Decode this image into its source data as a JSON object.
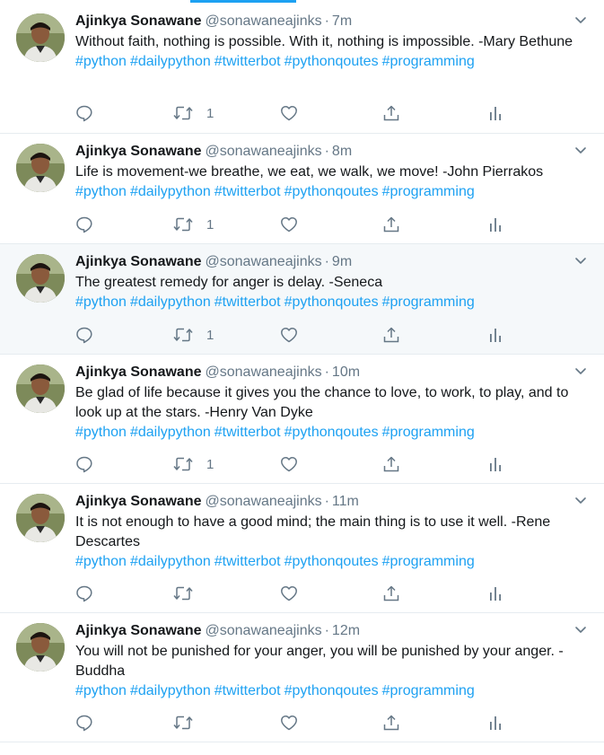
{
  "author": {
    "name": "Ajinkya Sonawane",
    "handle": "@sonawaneajinks",
    "separator": "·"
  },
  "tweets": [
    {
      "time": "7m",
      "text": "Without faith, nothing is possible. With it, nothing is impossible.  -Mary Bethune",
      "hashtags": [
        "#python",
        "#dailypython",
        "#twitterbot",
        "#pythonqoutes",
        "#programming"
      ],
      "retweet_count": "1",
      "hovered": false
    },
    {
      "time": "8m",
      "text": "Life is movement-we breathe, we eat, we walk, we move!  -John Pierrakos",
      "hashtags": [
        "#python",
        "#dailypython",
        "#twitterbot",
        "#pythonqoutes",
        "#programming"
      ],
      "retweet_count": "1",
      "hovered": false
    },
    {
      "time": "9m",
      "text": "The greatest remedy for anger is delay.  -Seneca",
      "hashtags": [
        "#python",
        "#dailypython",
        "#twitterbot",
        "#pythonqoutes",
        "#programming"
      ],
      "retweet_count": "1",
      "hovered": true
    },
    {
      "time": "10m",
      "text": "Be glad of life because it gives you the chance to love, to work, to play, and to look up at the stars.  -Henry Van Dyke",
      "hashtags": [
        "#python",
        "#dailypython",
        "#twitterbot",
        "#pythonqoutes",
        "#programming"
      ],
      "retweet_count": "1",
      "hovered": false
    },
    {
      "time": "11m",
      "text": "It is not enough to have a good mind; the main thing is to use it well.   -Rene Descartes",
      "hashtags": [
        "#python",
        "#dailypython",
        "#twitterbot",
        "#pythonqoutes",
        "#programming"
      ],
      "retweet_count": "",
      "hovered": false
    },
    {
      "time": "12m",
      "text": "You will not be punished for your anger, you will be punished by your anger.   -Buddha",
      "hashtags": [
        "#python",
        "#dailypython",
        "#twitterbot",
        "#pythonqoutes",
        "#programming"
      ],
      "retweet_count": "",
      "hovered": false
    }
  ],
  "icons": {
    "reply": "reply-icon",
    "retweet": "retweet-icon",
    "like": "like-icon",
    "share": "share-icon",
    "analytics": "analytics-icon",
    "caret": "chevron-down-icon"
  },
  "colors": {
    "accent": "#1da1f2",
    "muted": "#657786",
    "text": "#14171a",
    "hover_bg": "#f5f8fa",
    "divider": "#e6ecf0"
  }
}
